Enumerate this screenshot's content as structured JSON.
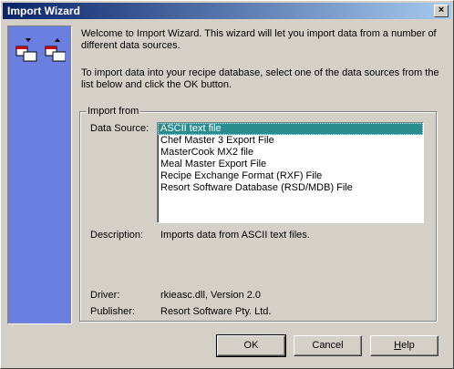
{
  "window": {
    "title": "Import Wizard",
    "close_glyph": "×"
  },
  "intro": {
    "line1": "Welcome to Import Wizard.  This wizard will let you import data from a number of different data sources.",
    "line2": "To import data into your recipe database, select one of the data sources from the list below and click the OK button."
  },
  "import_group": {
    "legend": "Import from",
    "data_source_label": "Data Source:",
    "sources": [
      "ASCII text file",
      "Chef Master 3 Export File",
      "MasterCook MX2 file",
      "Meal Master Export File",
      "Recipe Exchange Format (RXF) File",
      "Resort Software Database (RSD/MDB) File"
    ],
    "selected_index": 0,
    "description_label": "Description:",
    "description": "Imports data from ASCII text files.",
    "driver_label": "Driver:",
    "driver": "rkieasc.dll,  Version 2.0",
    "publisher_label": "Publisher:",
    "publisher": "Resort Software Pty. Ltd."
  },
  "buttons": {
    "ok": "OK",
    "cancel": "Cancel",
    "help_prefix": "",
    "help_underlined": "H",
    "help_rest": "elp"
  },
  "colors": {
    "sidebar": "#6b7fe0",
    "selection": "#2a8c8c",
    "title_start": "#0a246a"
  },
  "icons": {
    "sidebar": "import-wizard-icon"
  }
}
